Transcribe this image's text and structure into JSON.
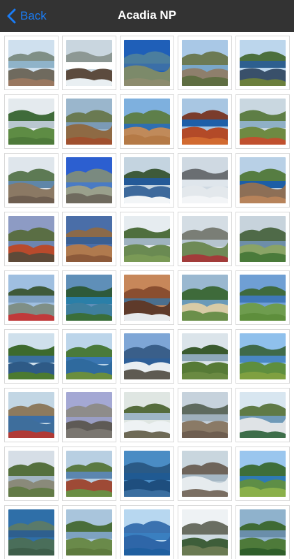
{
  "navbar": {
    "back_label": "Back",
    "title": "Acadia NP"
  },
  "colors": {
    "nav_bg": "#333333",
    "accent": "#1a7cf5",
    "title": "#ffffff"
  },
  "gallery": {
    "thumbnails": [
      {
        "sky": "#cfe0ee",
        "far": "#7f8f86",
        "mid": "#6f6a5e",
        "fg": "#9a7860",
        "water": "#8fb3c9"
      },
      {
        "sky": "#c9d6df",
        "far": "#8d9894",
        "mid": "#5c4b3e",
        "fg": "#e9eff2",
        "water": "#ffffff"
      },
      {
        "sky": "#1f5fb8",
        "far": "#4b7e9e",
        "mid": "#7c8a6a",
        "fg": "#8d8c6e",
        "water": "#3b6fa8"
      },
      {
        "sky": "#a9c8e6",
        "far": "#6c7a54",
        "mid": "#8e7f6c",
        "fg": "#5f6e42",
        "water": "#7aa7c9"
      },
      {
        "sky": "#bcd6ec",
        "far": "#4b6f3c",
        "mid": "#39506a",
        "fg": "#6b7f3c",
        "water": "#2d5f8f"
      },
      {
        "sky": "#e4eaee",
        "far": "#3f6b3a",
        "mid": "#5e8c44",
        "fg": "#4e7a3a",
        "water": "#b9c7cf"
      },
      {
        "sky": "#9ab6cc",
        "far": "#6a7a52",
        "mid": "#8e6a44",
        "fg": "#a0502e",
        "water": "#7b9ab5"
      },
      {
        "sky": "#7eb0de",
        "far": "#5e7f4a",
        "mid": "#c08a5a",
        "fg": "#b57a46",
        "water": "#2f6fb0"
      },
      {
        "sky": "#a8c6e2",
        "far": "#7a3c2c",
        "mid": "#b34a28",
        "fg": "#d26a30",
        "water": "#1e5fa8"
      },
      {
        "sky": "#c9d7e0",
        "far": "#5e7e46",
        "mid": "#6e8a42",
        "fg": "#c0502e",
        "water": "#8fb0c6"
      },
      {
        "sky": "#dfe6ec",
        "far": "#5d7a54",
        "mid": "#8b7964",
        "fg": "#6e5e50",
        "water": "#5f86a8"
      },
      {
        "sky": "#2c5fd0",
        "far": "#7a8a80",
        "mid": "#9aa08c",
        "fg": "#6f6a5e",
        "water": "#4a7bc4"
      },
      {
        "sky": "#c4d4e0",
        "far": "#3e5a3a",
        "mid": "#3e6a9c",
        "fg": "#f2f5f7",
        "water": "#245a98"
      },
      {
        "sky": "#cfd9e2",
        "far": "#6a6e72",
        "mid": "#e3e8ec",
        "fg": "#f3f5f7",
        "water": "#dfe6ec"
      },
      {
        "sky": "#b8d0e6",
        "far": "#567d42",
        "mid": "#8d6f56",
        "fg": "#b7835a",
        "water": "#1c5ea6"
      },
      {
        "sky": "#8d9bc4",
        "far": "#5a6e44",
        "mid": "#b84a2c",
        "fg": "#5e4a38",
        "water": "#6d85b0"
      },
      {
        "sky": "#4a6ea8",
        "far": "#8b6a4a",
        "mid": "#b07a4e",
        "fg": "#8d5a3a",
        "water": "#3a5f92"
      },
      {
        "sky": "#e6ecf0",
        "far": "#4f6f3e",
        "mid": "#6a8a52",
        "fg": "#7a9a56",
        "water": "#9fb3c0"
      },
      {
        "sky": "#d4dde4",
        "far": "#7a7e76",
        "mid": "#6e8a56",
        "fg": "#a23c3a",
        "water": "#b5c4cf"
      },
      {
        "sky": "#c7d3dc",
        "far": "#4f6a48",
        "mid": "#8aa466",
        "fg": "#4a7a3a",
        "water": "#6d8ea8"
      },
      {
        "sky": "#9fbfe0",
        "far": "#3f5a3a",
        "mid": "#7f8f86",
        "fg": "#c03a3a",
        "water": "#7c9fc2"
      },
      {
        "sky": "#5f8fb8",
        "far": "#2e5a3a",
        "mid": "#3f7f9e",
        "fg": "#3a6e3a",
        "water": "#2a7fa8"
      },
      {
        "sky": "#c7875a",
        "far": "#8a4e30",
        "mid": "#5e3a2a",
        "fg": "#e6e9ec",
        "water": "#4a6f8f"
      },
      {
        "sky": "#9ab8d0",
        "far": "#3e6a3a",
        "mid": "#d8cba6",
        "fg": "#6b8f4a",
        "water": "#6a9ab8"
      },
      {
        "sky": "#6f9fd4",
        "far": "#3f6a3e",
        "mid": "#6e9c4e",
        "fg": "#5e8e3c",
        "water": "#3f78b8"
      },
      {
        "sky": "#cfe0ec",
        "far": "#3d6a2e",
        "mid": "#2e5a86",
        "fg": "#4c7a30",
        "water": "#3a6e9e"
      },
      {
        "sky": "#bcd5ea",
        "far": "#4a7a3a",
        "mid": "#2f6a9e",
        "fg": "#6a8e3e",
        "water": "#3a76b2"
      },
      {
        "sky": "#7ea6d6",
        "far": "#3a5f8a",
        "mid": "#e9eef2",
        "fg": "#5e5a52",
        "water": "#2e5f98"
      },
      {
        "sky": "#dbe4ea",
        "far": "#3a5a2e",
        "mid": "#567a36",
        "fg": "#6a8a42",
        "water": "#8ea8ba"
      },
      {
        "sky": "#8fc0ec",
        "far": "#3f6a4a",
        "mid": "#5e8e3e",
        "fg": "#7fa040",
        "water": "#4a88c4"
      },
      {
        "sky": "#c2d6e4",
        "far": "#8d7a5e",
        "mid": "#3e6e9c",
        "fg": "#b03a36",
        "water": "#3c6ea4"
      },
      {
        "sky": "#a4a8d4",
        "far": "#8e8c8a",
        "mid": "#5e5a56",
        "fg": "#7a7670",
        "water": "#9a9ec4"
      },
      {
        "sky": "#dfe6e2",
        "far": "#556c3c",
        "mid": "#eef2f4",
        "fg": "#6e6a56",
        "water": "#9eb6c6"
      },
      {
        "sky": "#c6d2dc",
        "far": "#5e6a5e",
        "mid": "#8a7a66",
        "fg": "#6e5e50",
        "water": "#9fb0bc"
      },
      {
        "sky": "#d8e6f0",
        "far": "#5f7a46",
        "mid": "#dfe3e6",
        "fg": "#3e6e4a",
        "water": "#6f9ab8"
      },
      {
        "sky": "#d6dee6",
        "far": "#55703e",
        "mid": "#8a8a7a",
        "fg": "#627a46",
        "water": "#a3b6c4"
      },
      {
        "sky": "#b8cfe2",
        "far": "#5a7a42",
        "mid": "#9e4a36",
        "fg": "#6a8e44",
        "water": "#5c86b0"
      },
      {
        "sky": "#4a8cc4",
        "far": "#2a5a86",
        "mid": "#1e4e7e",
        "fg": "#3a6ea0",
        "water": "#205a92"
      },
      {
        "sky": "#c9d6de",
        "far": "#6e645a",
        "mid": "#e6ebee",
        "fg": "#7a6e62",
        "water": "#a5b7c4"
      },
      {
        "sky": "#9ac6ee",
        "far": "#3e6e3a",
        "mid": "#5e8e46",
        "fg": "#8ab04a",
        "water": "#2e7ab4"
      },
      {
        "sky": "#2f6fa8",
        "far": "#5a7a6a",
        "mid": "#4a6e5a",
        "fg": "#3e5e4a",
        "water": "#2e5f8e"
      },
      {
        "sky": "#a9c5dc",
        "far": "#4a6e3a",
        "mid": "#6a8a4a",
        "fg": "#5e7a3e",
        "water": "#7ea2c0"
      },
      {
        "sky": "#b7d7f0",
        "far": "#3b72b0",
        "mid": "#2e66a8",
        "fg": "#1f5fa0",
        "water": "#3a7fc0"
      },
      {
        "sky": "#eef2f4",
        "far": "#6a6e62",
        "mid": "#3e5e3a",
        "fg": "#6a7a52",
        "water": "#cfdbe2"
      },
      {
        "sky": "#8fb2cc",
        "far": "#3e6a34",
        "mid": "#4e7a3a",
        "fg": "#2f5e2a",
        "water": "#6a8eaa"
      }
    ]
  }
}
